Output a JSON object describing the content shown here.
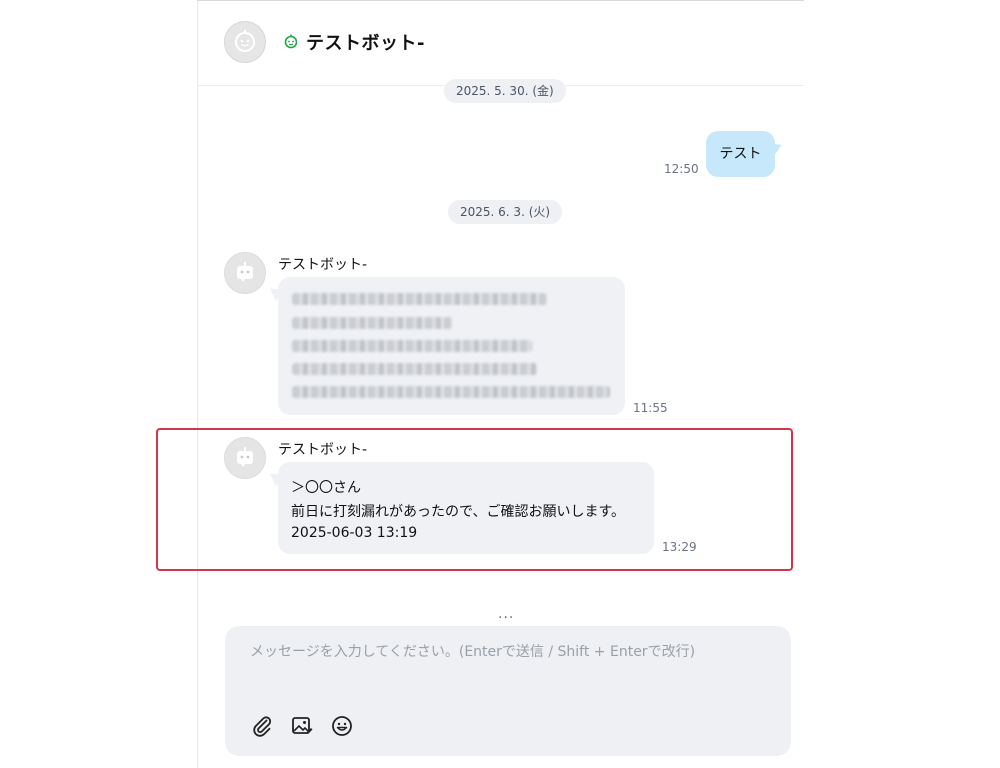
{
  "header": {
    "title": "テストボット-"
  },
  "dates": {
    "first": "2025. 5. 30. (金)",
    "second": "2025. 6. 3. (火)"
  },
  "messages": {
    "user_message": {
      "text": "テスト",
      "time": "12:50"
    },
    "bot_message_1": {
      "sender": "テストボット-",
      "time": "11:55"
    },
    "bot_message_2": {
      "sender": "テストボット-",
      "lines": [
        "＞〇〇さん",
        "前日に打刻漏れがあったので、ご確認お願いします。",
        "2025-06-03 13:19"
      ],
      "time": "13:29"
    }
  },
  "typing_indicator": "...",
  "composer": {
    "placeholder": "メッセージを入力してください。(Enterで送信 / Shift + Enterで改行)"
  },
  "colors": {
    "user_bubble": "#c7e8fb",
    "bot_bubble": "#eff1f5",
    "highlight_border": "#d1374b",
    "bot_status_icon": "#22a34a"
  },
  "icons": [
    "bot-avatar-icon",
    "bot-status-icon",
    "attach-icon",
    "image-icon",
    "emoji-icon"
  ]
}
